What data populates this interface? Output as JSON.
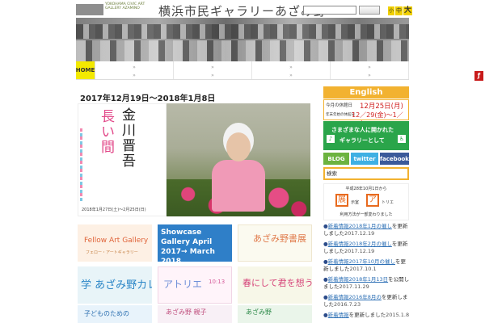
{
  "header": {
    "logo_text": "YOKOHAMA CIVIC ART GALLERY AZAMINO",
    "site_title": "横浜市民ギャラリーあざみ野",
    "font_sizes": [
      "小",
      "中",
      "大"
    ]
  },
  "nav": {
    "home_label": "HOME"
  },
  "main": {
    "exhibit_dates": "2017年12月19日～2018年1月8日",
    "poster": {
      "title_right": "金川晋吾",
      "title_left": "長い間",
      "dates": "2018年1月27日(土)～2月25日(日)"
    },
    "banners": [
      {
        "id": "fellow",
        "text": "Fellow Art Gallery",
        "sub": "フェロー・アートギャラリー"
      },
      {
        "id": "showcase",
        "text": "Showcase Gallery April 2017→ March 2018"
      },
      {
        "id": "azamino-calligraphy",
        "text": "あざみ野書展"
      },
      {
        "id": "college",
        "text": "学 あざみ野カレッジ"
      },
      {
        "id": "atelier",
        "text": "アトリエ",
        "sub": "10:13"
      },
      {
        "id": "spring",
        "text": "春にして君を想う"
      },
      {
        "id": "kids",
        "text": "子どものための"
      },
      {
        "id": "azamino-oya",
        "text": "あざみ野 親子"
      },
      {
        "id": "azamino-forum",
        "text": "あざみ野"
      }
    ]
  },
  "sidebar": {
    "english_label": "English",
    "closed_today_label": "今月の休館日",
    "closed_today_value": "12月25日(月)",
    "new_year_label": "年末年始の休館日",
    "new_year_value": "12／29(金)〜1／3(水)",
    "green_line1": "さまざまな人に開かれた",
    "green_line2": "ギャラリーとして",
    "social": [
      "BLOG",
      "twitter",
      "facebook"
    ],
    "search_placeholder": "検索",
    "atelier_top": "平成28年10月1日から",
    "atelier_box1": "展",
    "atelier_mid1": "示室",
    "atelier_box2": "ア",
    "atelier_mid2": "トリエ",
    "atelier_bottom": "利用方法が一部変わりました"
  },
  "news": [
    {
      "link": "新着情報2018年1月の催し",
      "text": "を更新しました",
      "date": "2017.12.19"
    },
    {
      "link": "新着情報2018年2月の催し",
      "text": "を更新しました",
      "date": "2017.12.19"
    },
    {
      "link": "新着情報2017年10月の催し",
      "text": "を更新しました",
      "date": "2017.10.1"
    },
    {
      "link": "新着情報2018年1月13日",
      "text": "を公開しました",
      "date": "2017.11.29"
    },
    {
      "link": "新着情報2016年8月の",
      "text": "を更新しました",
      "date": "2016.7.23"
    },
    {
      "link": "新着情報",
      "text": "を更新しました",
      "date": "2015.1.8"
    }
  ]
}
